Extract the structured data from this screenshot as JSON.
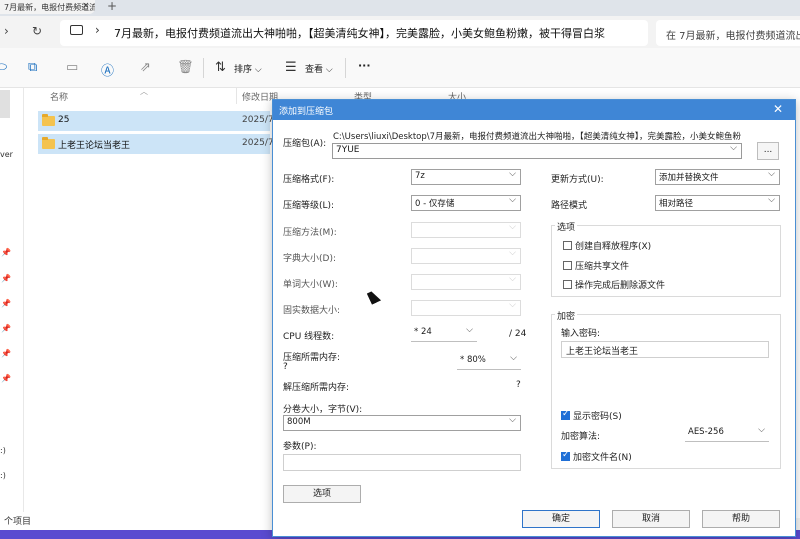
{
  "browser_tab": {
    "title": "7月最新，电报付费频道流出大",
    "close": "×",
    "new": "+"
  },
  "address_bar": {
    "path": "7月最新，电报付费频道流出大神啪啪，【超美清纯女神】，完美露脸，小美女鲍鱼粉嫩，被干得冒白浆"
  },
  "search_box": {
    "placeholder": "在 7月最新，电报付费频道流出大神啪啪"
  },
  "toolbar": {
    "sort_label": "排序",
    "view_label": "查看",
    "more_label": "···"
  },
  "left_pane": {
    "snippet1": "ver",
    "drive1": ":)",
    "drive2": ":)"
  },
  "file_list": {
    "headers": {
      "name": "名称",
      "date": "修改日期",
      "type": "类型",
      "size": "大小"
    },
    "rows": [
      {
        "name": "25",
        "date": "2025/7"
      },
      {
        "name": "上老王论坛当老王",
        "date": "2025/7"
      }
    ]
  },
  "status_bar": {
    "items_text": "个项目"
  },
  "dialog": {
    "title": "添加到压缩包",
    "archive_label": "压缩包(A):",
    "archive_path": "C:\\Users\\liuxi\\Desktop\\7月最新，电报付费频道流出大神啪啪，【超美清纯女神】，完美露脸，小美女鲍鱼粉",
    "archive_name": "7YUE",
    "browse_label": "...",
    "format_label": "压缩格式(F):",
    "format_value": "7z",
    "level_label": "压缩等级(L):",
    "level_value": "0 - 仅存储",
    "method_label": "压缩方法(M):",
    "dict_label": "字典大小(D):",
    "word_label": "单词大小(W):",
    "solid_label": "固实数据大小:",
    "cpu_label": "CPU 线程数:",
    "cpu_value": "* 24",
    "cpu_max": "/ 24",
    "mem_label": "压缩所需内存:",
    "mem_q": "?",
    "mem_value": "* 80%",
    "demem_label": "解压缩所需内存:",
    "demem_q": "?",
    "split_label": "分卷大小，字节(V):",
    "split_value": "800M",
    "params_label": "参数(P):",
    "options_button": "选项",
    "update_label": "更新方式(U):",
    "update_value": "添加并替换文件",
    "path_label": "路径模式",
    "path_value": "相对路径",
    "options_group": "选项",
    "opt_sfx": "创建自释放程序(X)",
    "opt_shared": "压缩共享文件",
    "opt_delete": "操作完成后删除源文件",
    "encrypt_group": "加密",
    "password_label": "输入密码:",
    "password_value": "上老王论坛当老王",
    "show_password": "显示密码(S)",
    "enc_method_label": "加密算法:",
    "enc_method_value": "AES-256",
    "enc_names": "加密文件名(N)",
    "ok": "确定",
    "cancel": "取消",
    "help": "帮助"
  },
  "colors": {
    "title_bar": "#3f86d6",
    "selection": "#cce4f7",
    "checkbox": "#1f6fd6",
    "taskbar": "#5a4bd0"
  }
}
